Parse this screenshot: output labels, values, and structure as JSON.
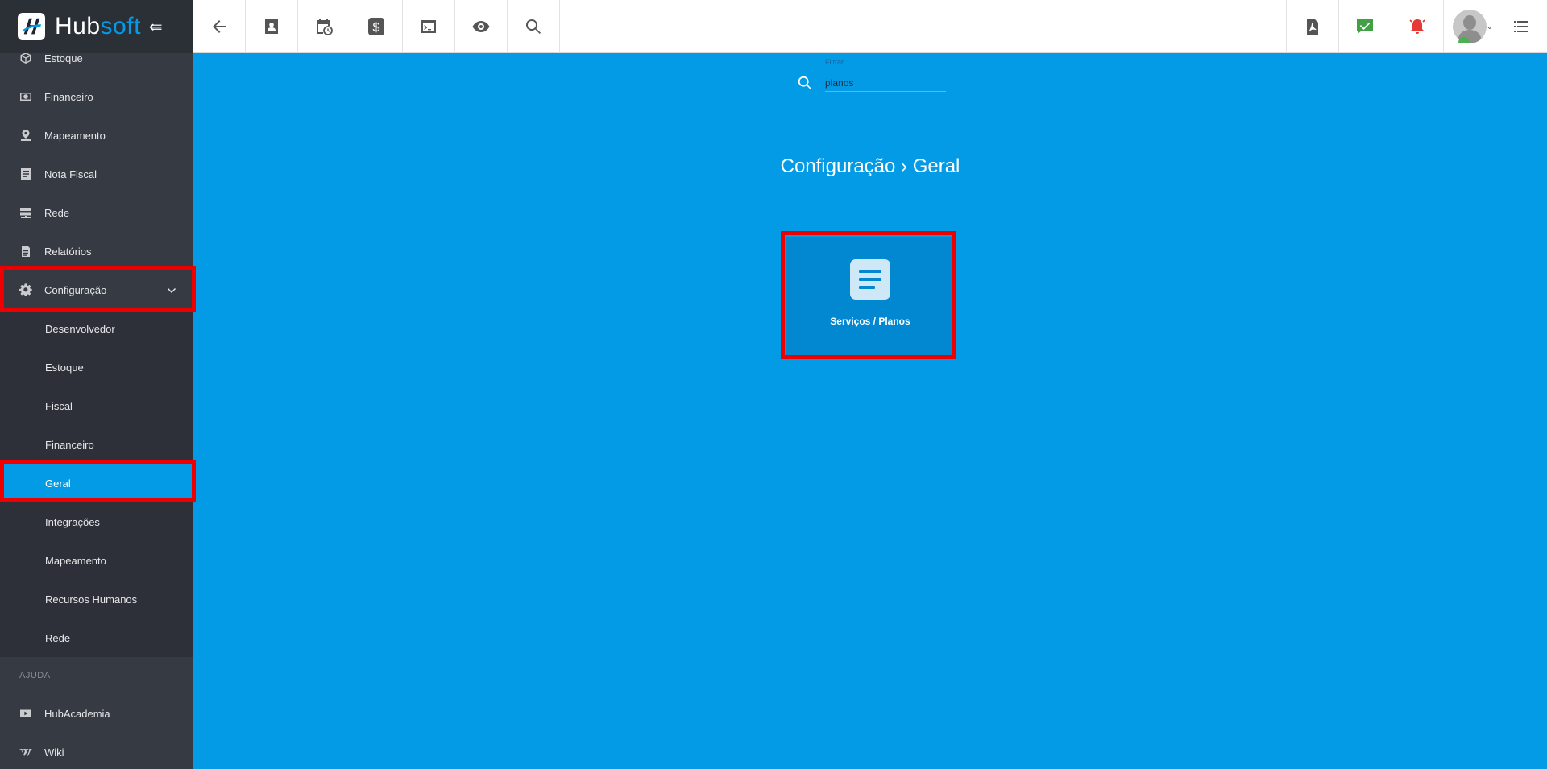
{
  "brand": {
    "logo_text_a": "Hub",
    "logo_text_b": "soft",
    "collapse_glyph": "⇚"
  },
  "sidebar": {
    "items": [
      {
        "label": "Estoque",
        "icon": "box-icon"
      },
      {
        "label": "Financeiro",
        "icon": "money-icon"
      },
      {
        "label": "Mapeamento",
        "icon": "map-pin-icon"
      },
      {
        "label": "Nota Fiscal",
        "icon": "document-icon"
      },
      {
        "label": "Rede",
        "icon": "server-icon"
      },
      {
        "label": "Relatórios",
        "icon": "report-icon"
      },
      {
        "label": "Configuração",
        "icon": "gear-icon",
        "expanded": true
      }
    ],
    "config_submenu": [
      {
        "label": "Desenvolvedor"
      },
      {
        "label": "Estoque"
      },
      {
        "label": "Fiscal"
      },
      {
        "label": "Financeiro"
      },
      {
        "label": "Geral",
        "active": true
      },
      {
        "label": "Integrações"
      },
      {
        "label": "Mapeamento"
      },
      {
        "label": "Recursos Humanos"
      },
      {
        "label": "Rede"
      }
    ],
    "help_section": "AJUDA",
    "help_items": [
      {
        "label": "HubAcademia",
        "icon": "youtube-icon"
      },
      {
        "label": "Wiki",
        "icon": "wikipedia-icon"
      }
    ]
  },
  "topbar": {
    "left_icons": [
      "back-arrow-icon",
      "contact-card-icon",
      "calendar-clock-icon",
      "dollar-icon",
      "terminal-icon",
      "eye-icon",
      "search-icon"
    ],
    "right_icons": [
      "pdf-icon",
      "chat-check-icon",
      "alarm-bell-icon",
      "avatar",
      "list-menu-icon"
    ],
    "colors": {
      "chat_check": "#43a047",
      "alarm_bell": "#e53935"
    }
  },
  "filter": {
    "label": "Filtrar",
    "value": "planos"
  },
  "breadcrumb": {
    "text": "Configuração › Geral"
  },
  "cards": [
    {
      "label": "Serviços / Planos",
      "icon": "document-lines-icon"
    }
  ],
  "colors": {
    "accent": "#039be5",
    "sidebar_bg": "#363a42",
    "highlight": "#ee0000"
  }
}
